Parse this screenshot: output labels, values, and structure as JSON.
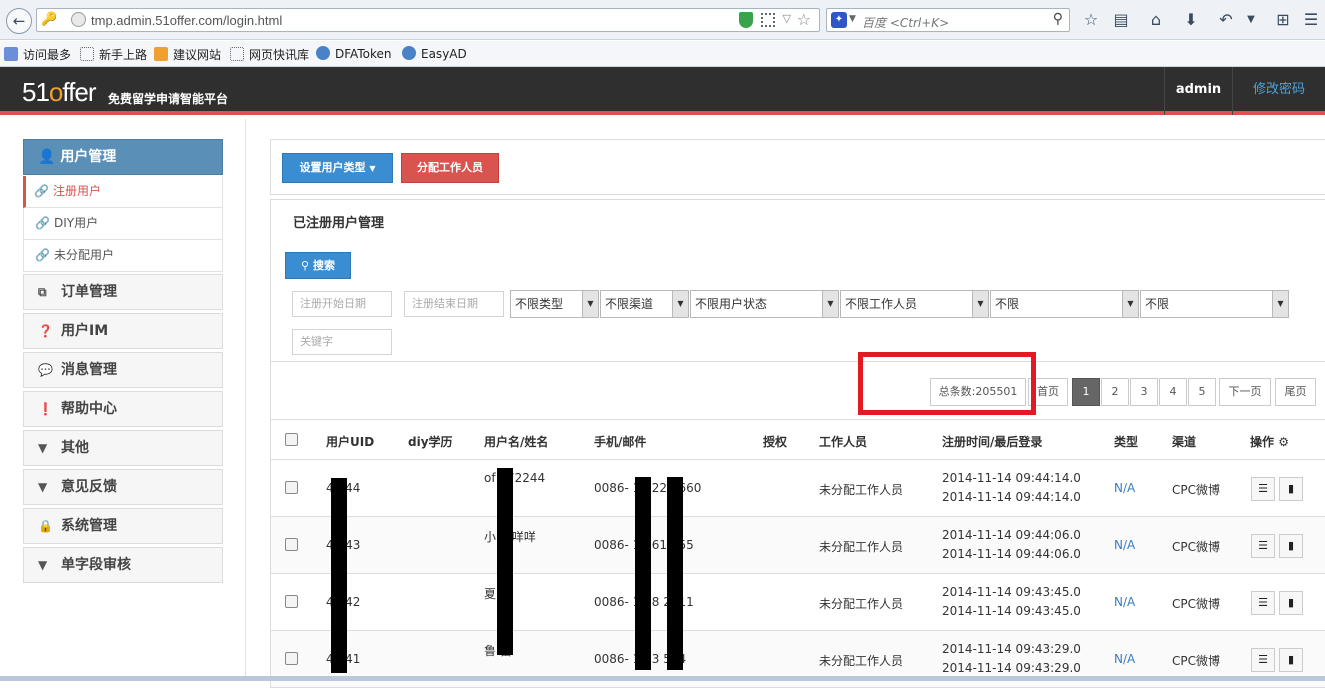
{
  "browser": {
    "url": "tmp.admin.51offer.com/login.html",
    "search_placeholder": "百度 <Ctrl+K>",
    "search_engine_icon": "baidu-paw-icon",
    "bookmarks": [
      "访问最多",
      "新手上路",
      "建议网站",
      "网页快讯库",
      "DFAToken",
      "EasyAD"
    ]
  },
  "header": {
    "logo_prefix": "51",
    "logo_o": "o",
    "logo_suffix": "ffer",
    "tagline": "免费留学申请智能平台",
    "user": "admin",
    "change_password": "修改密码",
    "accent_color": "#d9534f"
  },
  "sidebar": {
    "active_section": "用户管理",
    "subitems": [
      "注册用户",
      "DIY用户",
      "未分配用户"
    ],
    "items": [
      "订单管理",
      "用户IM",
      "消息管理",
      "帮助中心",
      "其他",
      "意见反馈",
      "系统管理",
      "单字段审核"
    ]
  },
  "actions": {
    "set_user_type": "设置用户类型",
    "assign_staff": "分配工作人员"
  },
  "filters": {
    "title": "已注册用户管理",
    "search_button": "搜索",
    "start_date_placeholder": "注册开始日期",
    "end_date_placeholder": "注册结束日期",
    "keyword_placeholder": "关键字",
    "selects": [
      "不限类型",
      "不限渠道",
      "不限用户状态",
      "不限工作人员",
      "不限",
      "不限"
    ]
  },
  "pagination": {
    "total": "总条数:205501",
    "first": "首页",
    "pages": [
      "1",
      "2",
      "3",
      "4",
      "5"
    ],
    "current": "1",
    "next": "下一页",
    "last": "尾页"
  },
  "table": {
    "columns": [
      "用户UID",
      "diy学历",
      "用户名/姓名",
      "手机/邮件",
      "授权",
      "工作人员",
      "注册时间/最后登录",
      "类型",
      "渠道",
      "操作"
    ],
    "rows": [
      {
        "uid": "4 244",
        "name": "of 472244",
        "phone": "0086- 1 922 7660",
        "staff": "未分配工作人员",
        "reg": "2014-11-14 09:44:14.0",
        "last": "2014-11-14 09:44:14.0",
        "type": "N/A",
        "channel": "CPC微博"
      },
      {
        "uid": "4 243",
        "name": "小 咩咩咩",
        "phone": "0086- 1 561 455",
        "staff": "未分配工作人员",
        "reg": "2014-11-14 09:44:06.0",
        "last": "2014-11-14 09:44:06.0",
        "type": "N/A",
        "channel": "CPC微博"
      },
      {
        "uid": "4 242",
        "name": "夏 亭",
        "phone": "0086- 1 98 2311",
        "staff": "未分配工作人员",
        "reg": "2014-11-14 09:43:45.0",
        "last": "2014-11-14 09:43:45.0",
        "type": "N/A",
        "channel": "CPC微博"
      },
      {
        "uid": "4 241",
        "name": "鲁 蕾",
        "phone": "0086- 1 53 564",
        "staff": "未分配工作人员",
        "reg": "2014-11-14 09:43:29.0",
        "last": "2014-11-14 09:43:29.0",
        "type": "N/A",
        "channel": "CPC微博"
      }
    ]
  }
}
